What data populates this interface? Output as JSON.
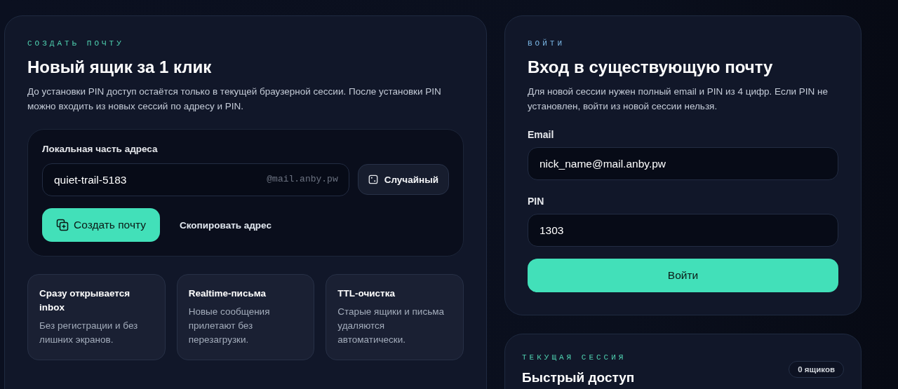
{
  "create": {
    "eyebrow": "СОЗДАТЬ ПОЧТУ",
    "title": "Новый ящик за 1 клик",
    "description": "До установки PIN доступ остаётся только в текущей браузерной сессии. После установки PIN можно входить из новых сессий по адресу и PIN.",
    "address": {
      "label": "Локальная часть адреса",
      "value": "quiet-trail-5183",
      "domain": "@mail.anby.pw"
    },
    "random_button": "Случайный",
    "create_button": "Создать почту",
    "copy_link": "Скопировать адрес",
    "features": [
      {
        "title": "Сразу открывается inbox",
        "text": "Без регистрации и без лишних экранов."
      },
      {
        "title": "Realtime-письма",
        "text": "Новые сообщения прилетают без перезагрузки."
      },
      {
        "title": "TTL-очистка",
        "text": "Старые ящики и письма удаляются автоматически."
      }
    ]
  },
  "login": {
    "eyebrow": "ВОЙТИ",
    "title": "Вход в существующую почту",
    "description": "Для новой сессии нужен полный email и PIN из 4 цифр. Если PIN не установлен, войти из новой сессии нельзя.",
    "fields": [
      {
        "label": "Email",
        "value": "nick_name@mail.anby.pw"
      },
      {
        "label": "PIN",
        "value": "1303"
      }
    ],
    "submit": "Войти"
  },
  "session": {
    "eyebrow": "ТЕКУЩАЯ СЕССИЯ",
    "title": "Быстрый доступ",
    "badge": "0 ящиков"
  }
}
